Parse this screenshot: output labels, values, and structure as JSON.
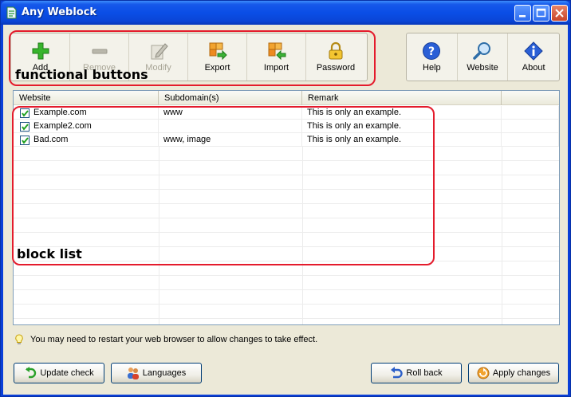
{
  "window": {
    "title": "Any Weblock"
  },
  "toolbar_left": [
    {
      "label": "Add",
      "icon": "plus-icon",
      "enabled": true
    },
    {
      "label": "Remove",
      "icon": "minus-icon",
      "enabled": false
    },
    {
      "label": "Modify",
      "icon": "edit-icon",
      "enabled": false
    },
    {
      "label": "Export",
      "icon": "export-icon",
      "enabled": true
    },
    {
      "label": "Import",
      "icon": "import-icon",
      "enabled": true
    },
    {
      "label": "Password",
      "icon": "lock-icon",
      "enabled": true
    }
  ],
  "toolbar_right": [
    {
      "label": "Help",
      "icon": "help-icon"
    },
    {
      "label": "Website",
      "icon": "magnifier-icon"
    },
    {
      "label": "About",
      "icon": "info-icon"
    }
  ],
  "list": {
    "columns": [
      "Website",
      "Subdomain(s)",
      "Remark"
    ],
    "rows": [
      {
        "checked": true,
        "website": "Example.com",
        "subdomains": "www",
        "remark": "This is only an example."
      },
      {
        "checked": true,
        "website": "Example2.com",
        "subdomains": "",
        "remark": "This is only an example."
      },
      {
        "checked": true,
        "website": "Bad.com",
        "subdomains": "www, image",
        "remark": "This is only an example."
      }
    ]
  },
  "annotations": {
    "functional": "functional buttons",
    "blocklist": "block list"
  },
  "hint": "You may need to restart your web browser to allow changes to take effect.",
  "buttons": {
    "update": "Update check",
    "languages": "Languages",
    "rollback": "Roll back",
    "apply": "Apply changes"
  },
  "colors": {
    "annotation": "#e41b2c",
    "titlebar": "#0a4ee6",
    "face": "#ece9d8"
  }
}
